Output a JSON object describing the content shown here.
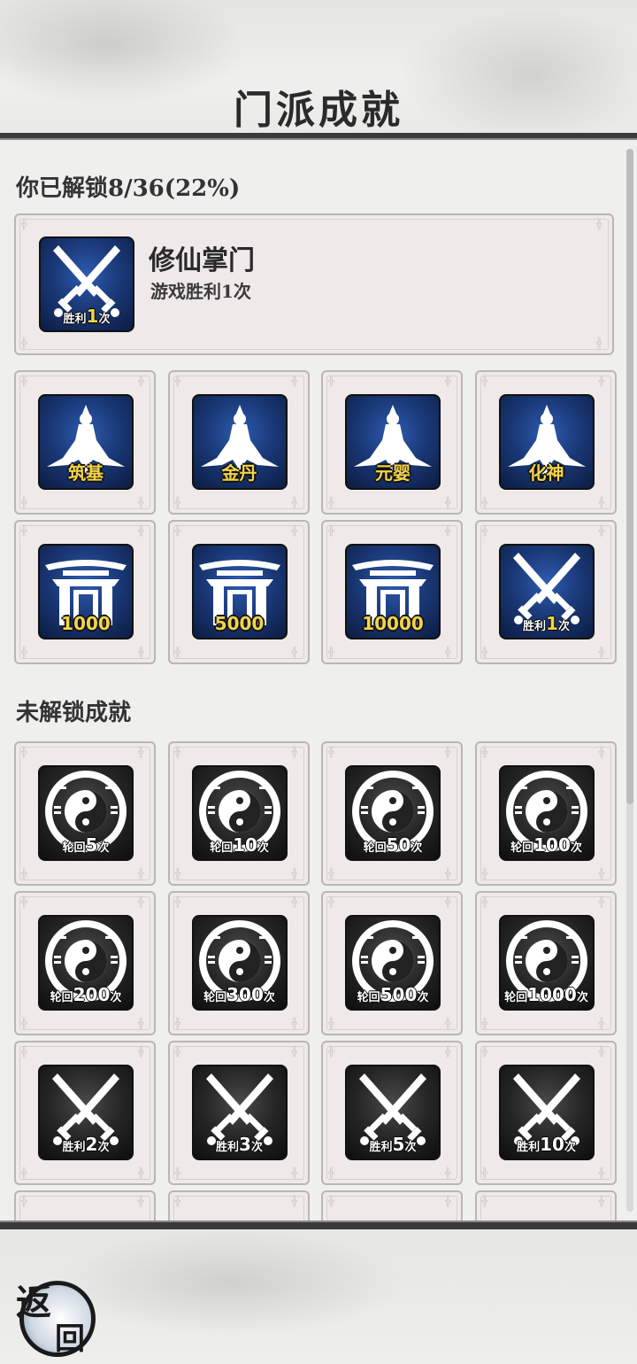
{
  "header": {
    "title": "门派成就"
  },
  "unlocked": {
    "summary": "你已解锁8/36(22%)",
    "featured": {
      "name": "修仙掌门",
      "desc": "游戏胜利1次",
      "icon": "crossed-swords-icon",
      "badge_prefix": "胜利",
      "badge_num": "1",
      "badge_suffix": "次"
    },
    "items": [
      {
        "icon": "immortal-figure-icon",
        "label": "筑基"
      },
      {
        "icon": "immortal-figure-icon",
        "label": "金丹"
      },
      {
        "icon": "immortal-figure-icon",
        "label": "元婴"
      },
      {
        "icon": "immortal-figure-icon",
        "label": "化神"
      },
      {
        "icon": "gate-icon",
        "label": "1000"
      },
      {
        "icon": "gate-icon",
        "label": "5000"
      },
      {
        "icon": "gate-icon",
        "label": "10000"
      },
      {
        "icon": "crossed-swords-icon",
        "label_prefix": "胜利",
        "label_num": "1",
        "label_suffix": "次"
      }
    ]
  },
  "locked": {
    "title": "未解锁成就",
    "items": [
      {
        "icon": "yin-yang-icon",
        "prefix": "轮回",
        "num": "5",
        "suffix": "次"
      },
      {
        "icon": "yin-yang-icon",
        "prefix": "轮回",
        "num": "10",
        "suffix": "次"
      },
      {
        "icon": "yin-yang-icon",
        "prefix": "轮回",
        "num": "50",
        "suffix": "次"
      },
      {
        "icon": "yin-yang-icon",
        "prefix": "轮回",
        "num": "100",
        "suffix": "次"
      },
      {
        "icon": "yin-yang-icon",
        "prefix": "轮回",
        "num": "200",
        "suffix": "次"
      },
      {
        "icon": "yin-yang-icon",
        "prefix": "轮回",
        "num": "300",
        "suffix": "次"
      },
      {
        "icon": "yin-yang-icon",
        "prefix": "轮回",
        "num": "500",
        "suffix": "次"
      },
      {
        "icon": "yin-yang-icon",
        "prefix": "轮回",
        "num": "1000",
        "suffix": "次"
      },
      {
        "icon": "crossed-swords-icon",
        "prefix": "胜利",
        "num": "2",
        "suffix": "次"
      },
      {
        "icon": "crossed-swords-icon",
        "prefix": "胜利",
        "num": "3",
        "suffix": "次"
      },
      {
        "icon": "crossed-swords-icon",
        "prefix": "胜利",
        "num": "5",
        "suffix": "次"
      },
      {
        "icon": "crossed-swords-icon",
        "prefix": "胜利",
        "num": "10",
        "suffix": "次"
      }
    ]
  },
  "footer": {
    "back_char1": "返",
    "back_char2": "回"
  },
  "colors": {
    "unlocked_icon_bg": "#1b3a7a",
    "locked_icon_bg": "#262626",
    "badge_gold": "#f3d44a"
  }
}
